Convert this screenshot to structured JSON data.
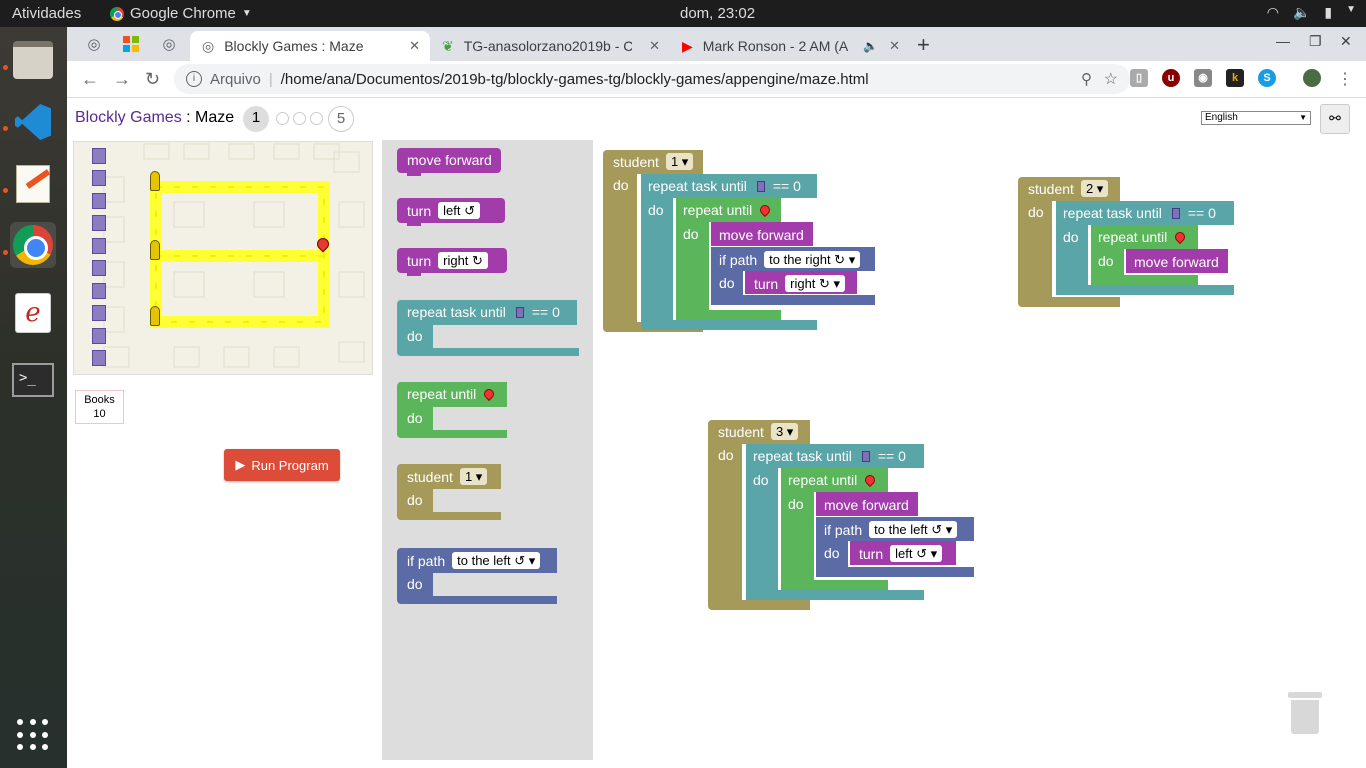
{
  "os": {
    "activities": "Atividades",
    "app_name": "Google Chrome",
    "clock": "dom, 23:02"
  },
  "browser": {
    "tabs": [
      {
        "label": "Blockly Games : Maze",
        "active": true
      },
      {
        "label": "TG-anasolorzano2019b - C"
      },
      {
        "label": "Mark Ronson - 2 AM (A"
      }
    ],
    "address_prefix": "Arquivo",
    "address": "/home/ana/Documentos/2019b-tg/blockly-games-tg/blockly-games/appengine/maze.html"
  },
  "page": {
    "brand": "Blockly Games",
    "separator": " : ",
    "game": "Maze",
    "current_level": "1",
    "last_level": "5",
    "language": "English",
    "books_label": "Books",
    "books_count": "10",
    "run_button": "Run Program"
  },
  "toolbox": {
    "move_forward": "move forward",
    "turn": "turn",
    "left": "left ↺",
    "right": "right ↻",
    "repeat_task_until": "repeat task until",
    "eq_zero": "== 0",
    "do": "do",
    "repeat_until": "repeat until",
    "student": "student",
    "student_num": "1",
    "if_path": "if path",
    "to_the_left": "to the left ↺"
  },
  "workspace": {
    "s1": {
      "student": "student",
      "num": "1",
      "do": "do",
      "repeat_task_until": "repeat task until",
      "eq": "== 0",
      "repeat_until": "repeat until",
      "move_forward": "move forward",
      "if_path": "if path",
      "direction": "to the right ↻",
      "turn": "turn",
      "turn_dir": "right ↻"
    },
    "s2": {
      "student": "student",
      "num": "2",
      "do": "do",
      "repeat_task_until": "repeat task until",
      "eq": "== 0",
      "repeat_until": "repeat until",
      "move_forward": "move forward"
    },
    "s3": {
      "student": "student",
      "num": "3",
      "do": "do",
      "repeat_task_until": "repeat task until",
      "eq": "== 0",
      "repeat_until": "repeat until",
      "move_forward": "move forward",
      "if_path": "if path",
      "direction": "to the left ↺",
      "turn": "turn",
      "turn_dir": "left ↺"
    }
  },
  "colors": {
    "movement": "#a23cab",
    "loop_task": "#5aa5a8",
    "loop_until": "#5bb55b",
    "student": "#a59a5a",
    "logic": "#5b6ba5"
  }
}
